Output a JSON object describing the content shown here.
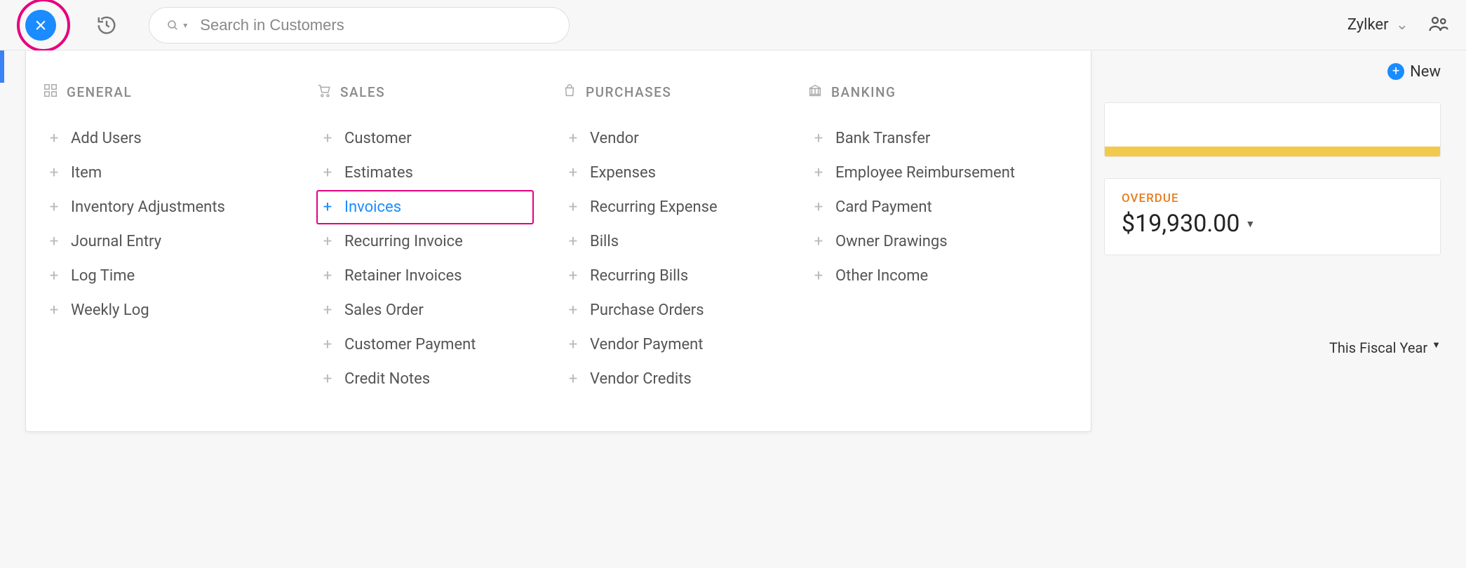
{
  "header": {
    "search_placeholder": "Search in Customers",
    "org_name": "Zylker"
  },
  "quick_create": {
    "columns": [
      {
        "key": "general",
        "title": "GENERAL",
        "icon": "grid",
        "items": [
          {
            "label": "Add Users"
          },
          {
            "label": "Item"
          },
          {
            "label": "Inventory Adjustments"
          },
          {
            "label": "Journal Entry"
          },
          {
            "label": "Log Time"
          },
          {
            "label": "Weekly Log"
          }
        ]
      },
      {
        "key": "sales",
        "title": "SALES",
        "icon": "cart",
        "items": [
          {
            "label": "Customer"
          },
          {
            "label": "Estimates"
          },
          {
            "label": "Invoices",
            "highlight": true
          },
          {
            "label": "Recurring Invoice"
          },
          {
            "label": "Retainer Invoices"
          },
          {
            "label": "Sales Order"
          },
          {
            "label": "Customer Payment"
          },
          {
            "label": "Credit Notes"
          }
        ]
      },
      {
        "key": "purchases",
        "title": "PURCHASES",
        "icon": "bag",
        "items": [
          {
            "label": "Vendor"
          },
          {
            "label": "Expenses"
          },
          {
            "label": "Recurring Expense"
          },
          {
            "label": "Bills"
          },
          {
            "label": "Recurring Bills"
          },
          {
            "label": "Purchase Orders"
          },
          {
            "label": "Vendor Payment"
          },
          {
            "label": "Vendor Credits"
          }
        ]
      },
      {
        "key": "banking",
        "title": "BANKING",
        "icon": "bank",
        "items": [
          {
            "label": "Bank Transfer"
          },
          {
            "label": "Employee Reimbursement"
          },
          {
            "label": "Card Payment"
          },
          {
            "label": "Owner Drawings"
          },
          {
            "label": "Other Income"
          }
        ]
      }
    ]
  },
  "right": {
    "new_label": "New",
    "overdue_label": "OVERDUE",
    "overdue_amount": "$19,930.00",
    "fiscal_year_label": "This Fiscal Year"
  }
}
